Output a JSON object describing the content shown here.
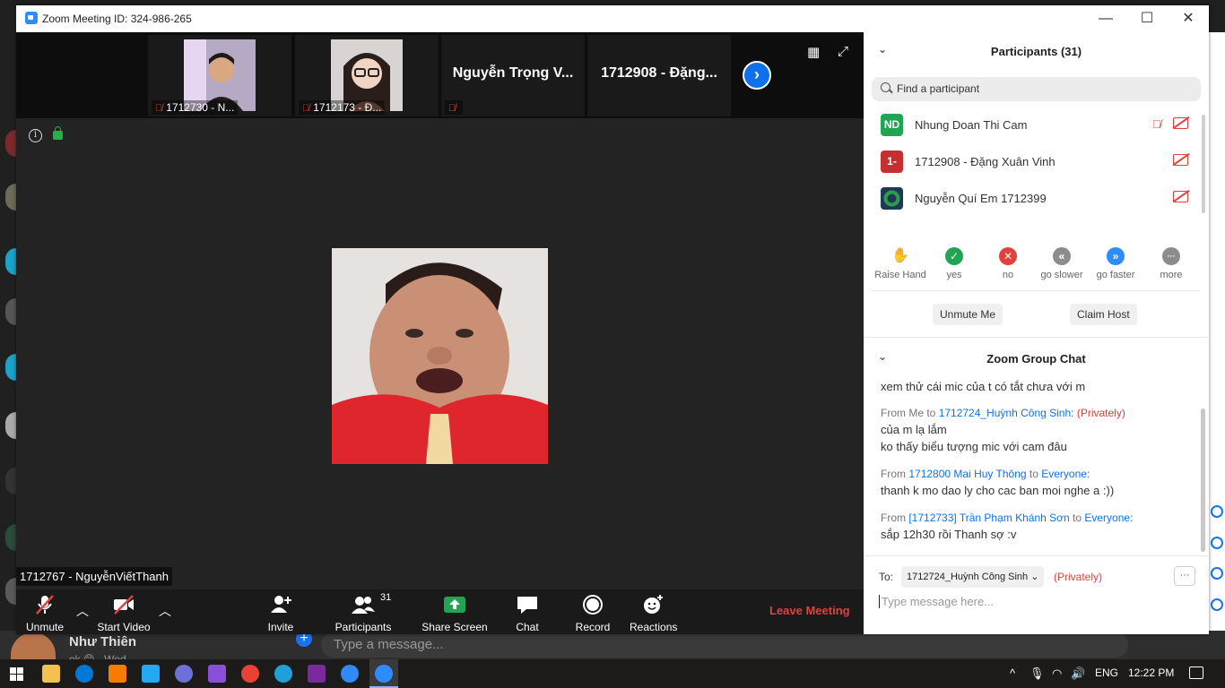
{
  "window": {
    "title": "Zoom Meeting ID: 324-986-265",
    "minimize": "—",
    "maximize": "☐",
    "close": "✕"
  },
  "gallery": {
    "thumbs": [
      {
        "label": "1712730 - N..."
      },
      {
        "label": "1712173 - Đ..."
      },
      {
        "name": "Nguyễn Trọng V..."
      },
      {
        "name": "1712908 - Đặng..."
      }
    ],
    "next_page": "›"
  },
  "speaker": {
    "label": "1712767 - NguyễnViếtThanh"
  },
  "toolbar": {
    "unmute": "Unmute",
    "start_video": "Start Video",
    "invite": "Invite",
    "participants": "Participants",
    "participant_count": "31",
    "share_screen": "Share Screen",
    "chat": "Chat",
    "record": "Record",
    "reactions": "Reactions",
    "leave": "Leave Meeting"
  },
  "participants_panel": {
    "title": "Participants (31)",
    "search_placeholder": "Find a participant",
    "rows": [
      {
        "initials": "ND",
        "name": "Nhung Doan Thi Cam",
        "color": "#23a455"
      },
      {
        "initials": "1-",
        "name": "1712908 - Đặng Xuân Vinh",
        "color": "#c62f2f"
      },
      {
        "initials": "",
        "name": "Nguyễn Quí Em 1712399",
        "color": "#1d3a55"
      }
    ],
    "reactions": [
      {
        "label": "Raise Hand",
        "icon": "✋",
        "color": "#2d8cff"
      },
      {
        "label": "yes",
        "icon": "✓",
        "color": "#23a455"
      },
      {
        "label": "no",
        "icon": "✕",
        "color": "#e0413d"
      },
      {
        "label": "go slower",
        "icon": "«",
        "color": "#8c8c8c"
      },
      {
        "label": "go faster",
        "icon": "»",
        "color": "#2d8cff"
      },
      {
        "label": "more",
        "icon": "···",
        "color": "#8c8c8c"
      }
    ],
    "unmute_me": "Unmute Me",
    "claim_host": "Claim Host"
  },
  "chat_panel": {
    "title": "Zoom Group Chat",
    "messages": {
      "m0": "xem thử cái mic của t có tắt chưa với m",
      "g1_from": "From Me to",
      "g1_to": "1712724_Huỳnh Công Sinh:",
      "g1_priv": "(Privately)",
      "m1": "của m lạ lắm",
      "m2": "ko thấy biểu tượng mic với cam đâu",
      "g2_from": "From",
      "g2_sender": "1712800 Mai Huy Thông",
      "g2_to_word": "to",
      "g2_to": "Everyone:",
      "m3": "thanh k mo dao ly cho cac ban moi nghe a :))",
      "g3_from": "From",
      "g3_sender": "[1712733] Trần Phạm Khánh Sơn",
      "g3_to_word": "to",
      "g3_to": "Everyone:",
      "m4": "sắp 12h30 rồi Thanh sợ :v"
    },
    "to_label": "To:",
    "to_value": "1712724_Huỳnh Công Sinh ⌄",
    "to_priv": "(Privately)",
    "more": "···",
    "input_placeholder": "Type message here..."
  },
  "background_app": {
    "contact_name": "Như Thiên",
    "contact_sub": "ok 😊 · Wed",
    "message_placeholder": "Type a message...",
    "plus": "+"
  },
  "taskbar": {
    "language": "ENG",
    "time": "12:22 PM",
    "tray_caret": "^",
    "mic": "🎙",
    "wifi": "◠",
    "volume": "🔊"
  },
  "colors": {
    "zoom_blue": "#2d8cff",
    "danger_red": "#e0413d",
    "share_green": "#23a455"
  }
}
